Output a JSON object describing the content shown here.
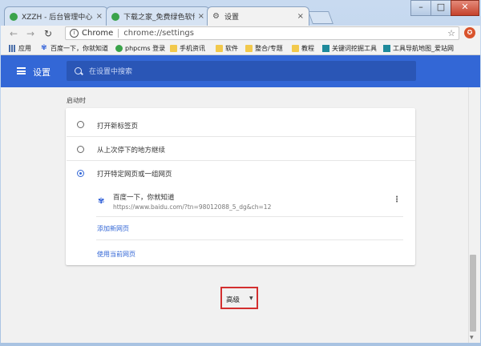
{
  "tabs": [
    {
      "title": "XZZH - 后台管理中心",
      "close": "×"
    },
    {
      "title": "下载之家_免费绿色软件",
      "close": "×"
    },
    {
      "title": "设置",
      "close": "×"
    }
  ],
  "window": {
    "minimize": "–",
    "maximize": "□",
    "close": "✕"
  },
  "toolbar": {
    "back": "←",
    "forward": "→",
    "reload": "↻",
    "scheme": "Chrome",
    "url": "chrome://settings",
    "star": "☆",
    "extension": "✪"
  },
  "bookmarks": [
    {
      "label": "应用",
      "icon": "apps-grid-icon"
    },
    {
      "label": "百度一下，你就知道",
      "icon": "baidu-paw-icon"
    },
    {
      "label": "phpcms 登录",
      "icon": "site-icon"
    },
    {
      "label": "手机资讯",
      "icon": "folder-icon"
    },
    {
      "label": "软件",
      "icon": "folder-icon"
    },
    {
      "label": "整合/专题",
      "icon": "folder-icon"
    },
    {
      "label": "教程",
      "icon": "folder-icon"
    },
    {
      "label": "关键词挖掘工具",
      "icon": "site-icon"
    },
    {
      "label": "工具导航地图_爱站网",
      "icon": "site-icon"
    }
  ],
  "header": {
    "title": "设置",
    "search_placeholder": "在设置中搜索"
  },
  "startup": {
    "section_label": "启动时",
    "options": [
      {
        "label": "打开新标签页",
        "selected": false
      },
      {
        "label": "从上次停下的地方继续",
        "selected": false
      },
      {
        "label": "打开特定网页或一组网页",
        "selected": true
      }
    ],
    "page": {
      "name": "百度一下，你就知道",
      "url": "https://www.baidu.com/?tn=98012088_5_dg&ch=12",
      "menu": "⋮"
    },
    "add_page": "添加新网页",
    "use_current": "使用当前网页"
  },
  "advanced": {
    "label": "高级",
    "arrow": "▼"
  },
  "colors": {
    "accent": "#3367d6",
    "highlight": "#d32f2f"
  }
}
